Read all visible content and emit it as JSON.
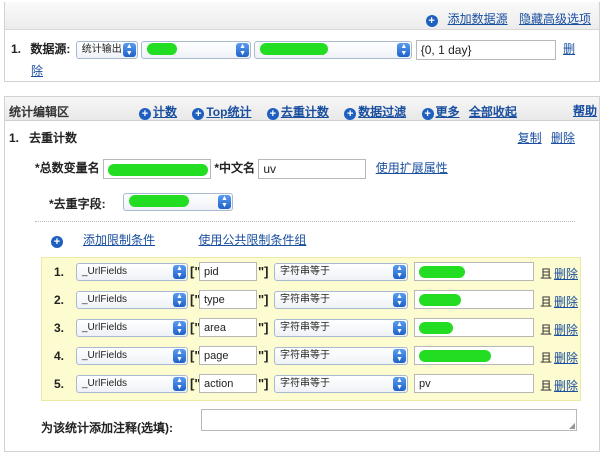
{
  "top": {
    "add_source": "添加数据源",
    "hide_advanced": "隐藏高级选项",
    "row_num": "1.",
    "source_label": "数据源:",
    "source_type": "统计输出",
    "time_range": "{0, 1 day}",
    "delete_part1": "删",
    "delete_part2": "除"
  },
  "edit": {
    "title": "统计编辑区",
    "actions": [
      "计数",
      "Top统计",
      "去重计数",
      "数据过滤",
      "更多"
    ],
    "collapse_all": "全部收起",
    "help": "帮助",
    "distinct_title": "1.   去重计数",
    "copy": "复制",
    "delete": "删除",
    "var_label": "*总数变量名",
    "cn_label": "*中文名",
    "cn_value": "uv",
    "ext_attr": "使用扩展属性",
    "dedupe_label": "*去重字段:",
    "add_limit": "添加限制条件",
    "use_public_limit": "使用公共限制条件组",
    "conditions": [
      {
        "num": "1.",
        "field": "_UrlFields",
        "open": "[\"",
        "key": "pid",
        "close": "\"]",
        "op": "字符串等于",
        "value": "",
        "and": "且",
        "del": "删除"
      },
      {
        "num": "2.",
        "field": "_UrlFields",
        "open": "[\"",
        "key": "type",
        "close": "\"]",
        "op": "字符串等于",
        "value": "",
        "and": "且",
        "del": "删除"
      },
      {
        "num": "3.",
        "field": "_UrlFields",
        "open": "[\"",
        "key": "area",
        "close": "\"]",
        "op": "字符串等于",
        "value": "",
        "and": "且",
        "del": "删除"
      },
      {
        "num": "4.",
        "field": "_UrlFields",
        "open": "[\"",
        "key": "page",
        "close": "\"]",
        "op": "字符串等于",
        "value": "",
        "and": "且",
        "del": "删除"
      },
      {
        "num": "5.",
        "field": "_UrlFields",
        "open": "[\"",
        "key": "action",
        "close": "\"]",
        "op": "字符串等于",
        "value": "pv",
        "and": "且",
        "del": "删除"
      }
    ],
    "note_label": "为该统计添加注释(选填):"
  },
  "colors": {
    "link": "#1a4fa0",
    "redaction": "#22dd22",
    "condition_bg": "#fdfbd0"
  }
}
